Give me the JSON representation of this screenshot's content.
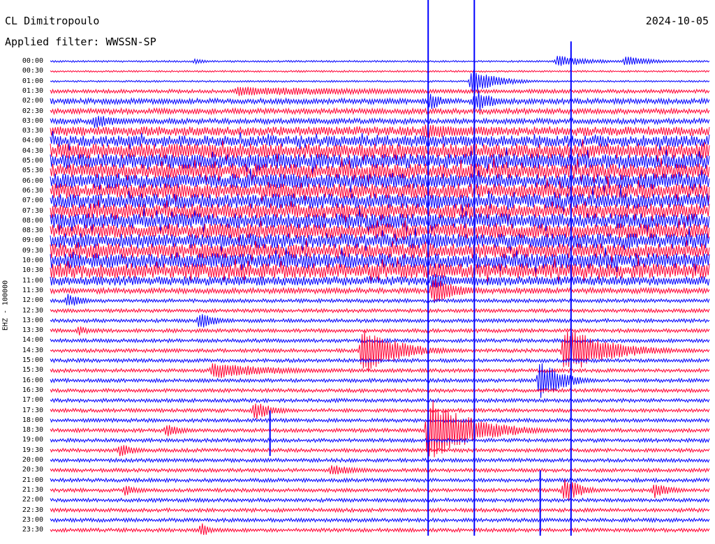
{
  "header": {
    "station": "CL Dimitropoulo",
    "filter": "Applied filter: WWSSN-SP",
    "date": "2024-10-05"
  },
  "axis": {
    "channel_label": "EHZ - 100000"
  },
  "chart_data": {
    "type": "line",
    "title": "CL Dimitropoulo",
    "subtitle": "Applied filter: WWSSN-SP",
    "date": "2024-10-05",
    "ylabel": "EHZ - 100000",
    "row_minutes": 30,
    "row_labels": [
      "00:00",
      "00:30",
      "01:00",
      "01:30",
      "02:00",
      "02:30",
      "03:00",
      "03:30",
      "04:00",
      "04:30",
      "05:00",
      "05:30",
      "06:00",
      "06:30",
      "07:00",
      "07:30",
      "08:00",
      "08:30",
      "09:00",
      "09:30",
      "10:00",
      "10:30",
      "11:00",
      "11:30",
      "12:00",
      "12:30",
      "13:00",
      "13:30",
      "14:00",
      "14:30",
      "15:00",
      "15:30",
      "16:00",
      "16:30",
      "17:00",
      "17:30",
      "18:00",
      "18:30",
      "19:00",
      "19:30",
      "20:00",
      "20:30",
      "21:00",
      "21:30",
      "22:00",
      "22:30",
      "23:00",
      "23:30"
    ],
    "row_colors": [
      "#0000ff",
      "#ff0033"
    ],
    "noise_level": [
      1,
      1,
      1,
      2,
      3,
      3,
      3,
      5,
      6,
      8,
      8,
      8,
      8,
      8,
      8,
      8,
      8,
      8,
      8,
      8,
      8,
      8,
      5,
      3,
      2,
      2,
      2,
      2,
      2,
      2,
      2,
      2,
      2,
      2,
      2,
      2,
      2,
      2,
      2,
      2,
      2,
      2,
      2,
      2,
      2,
      2,
      2,
      2
    ],
    "events": [
      {
        "row": 0,
        "minute": 6.6,
        "peak": 4,
        "dur_min": 0.6
      },
      {
        "row": 0,
        "minute": 26.2,
        "peak": 8,
        "dur_min": 1.2
      },
      {
        "row": 0,
        "minute": 23.1,
        "peak": 9,
        "dur_min": 1.5
      },
      {
        "row": 2,
        "minute": 19.2,
        "peak": 18,
        "dur_min": 1.2
      },
      {
        "row": 3,
        "minute": 8.5,
        "peak": 7,
        "dur_min": 9
      },
      {
        "row": 4,
        "minute": 19.3,
        "peak": 12,
        "dur_min": 1.0
      },
      {
        "row": 4,
        "minute": 19.5,
        "peak": 15,
        "dur_min": 0.8
      },
      {
        "row": 4,
        "minute": 17.3,
        "peak": 14,
        "dur_min": 0.6
      },
      {
        "row": 6,
        "minute": 2.0,
        "peak": 10,
        "dur_min": 1.5
      },
      {
        "row": 7,
        "minute": 17.0,
        "peak": 12,
        "dur_min": 2.5
      },
      {
        "row": 21,
        "minute": 17.5,
        "peak": 12,
        "dur_min": 1.5
      },
      {
        "row": 22,
        "minute": 17.4,
        "peak": 12,
        "dur_min": 1.2
      },
      {
        "row": 23,
        "minute": 17.4,
        "peak": 20,
        "dur_min": 1.2
      },
      {
        "row": 24,
        "minute": 0.8,
        "peak": 10,
        "dur_min": 0.8
      },
      {
        "row": 26,
        "minute": 6.8,
        "peak": 13,
        "dur_min": 0.8
      },
      {
        "row": 27,
        "minute": 1.3,
        "peak": 7,
        "dur_min": 0.6
      },
      {
        "row": 29,
        "minute": 14.2,
        "peak": 36,
        "dur_min": 1.6
      },
      {
        "row": 29,
        "minute": 23.4,
        "peak": 36,
        "dur_min": 2.0
      },
      {
        "row": 31,
        "minute": 7.4,
        "peak": 12,
        "dur_min": 3.0
      },
      {
        "row": 32,
        "minute": 22.3,
        "peak": 30,
        "dur_min": 1.0
      },
      {
        "row": 35,
        "minute": 9.3,
        "peak": 14,
        "dur_min": 1.0
      },
      {
        "row": 37,
        "minute": 5.3,
        "peak": 10,
        "dur_min": 0.8
      },
      {
        "row": 37,
        "minute": 17.2,
        "peak": 48,
        "dur_min": 2.0
      },
      {
        "row": 39,
        "minute": 3.2,
        "peak": 10,
        "dur_min": 0.8
      },
      {
        "row": 41,
        "minute": 12.8,
        "peak": 8,
        "dur_min": 1.5
      },
      {
        "row": 43,
        "minute": 3.4,
        "peak": 8,
        "dur_min": 0.8
      },
      {
        "row": 43,
        "minute": 27.5,
        "peak": 12,
        "dur_min": 0.8
      },
      {
        "row": 43,
        "minute": 23.4,
        "peak": 20,
        "dur_min": 0.8
      },
      {
        "row": 47,
        "minute": 6.9,
        "peak": 12,
        "dur_min": 0.4
      }
    ],
    "glitches": [
      {
        "row": 0,
        "minute": 17.2,
        "rows_up": 7,
        "rows_down": 47
      },
      {
        "row": 0,
        "minute": 19.3,
        "rows_up": 7,
        "rows_down": 47
      },
      {
        "row": 0,
        "minute": 23.7,
        "rows_up": 2,
        "rows_down": 47
      },
      {
        "row": 36,
        "minute": 10.0,
        "rows_up": 1,
        "rows_down": 3
      },
      {
        "row": 42,
        "minute": 22.3,
        "rows_up": 1,
        "rows_down": 5
      }
    ]
  }
}
